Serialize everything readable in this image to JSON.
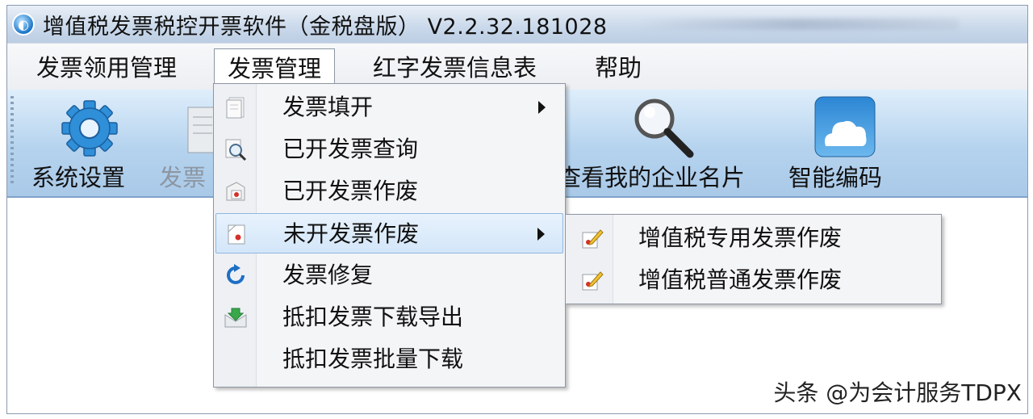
{
  "window": {
    "title": "增值税发票税控开票软件（金税盘版） V2.2.32.181028",
    "icon": "app-logo-icon"
  },
  "menubar": {
    "items": [
      {
        "label": "发票领用管理"
      },
      {
        "label": "发票管理",
        "active": true
      },
      {
        "label": "红字发票信息表"
      },
      {
        "label": "帮助"
      }
    ]
  },
  "toolbar": {
    "buttons": [
      {
        "label": "系统设置",
        "icon": "gear-icon"
      },
      {
        "label": "发票",
        "icon": "invoice-icon",
        "partially_hidden": true
      },
      {
        "label": "查看我的企业名片",
        "icon": "magnifier-icon",
        "partially_hidden": true
      },
      {
        "label": "智能编码",
        "icon": "cloud-icon"
      }
    ]
  },
  "dropdown": {
    "items": [
      {
        "label": "发票填开",
        "icon": "invoice-fill-icon",
        "has_submenu": true
      },
      {
        "label": "已开发票查询",
        "icon": "invoice-search-icon"
      },
      {
        "label": "已开发票作废",
        "icon": "invoice-void-icon"
      },
      {
        "label": "未开发票作废",
        "icon": "blank-invoice-void-icon",
        "has_submenu": true,
        "highlighted": true
      },
      {
        "label": "发票修复",
        "icon": "repair-refresh-icon"
      },
      {
        "label": "抵扣发票下载导出",
        "icon": "download-export-icon"
      },
      {
        "label": "抵扣发票批量下载",
        "icon": ""
      }
    ]
  },
  "submenu": {
    "items": [
      {
        "label": "增值税专用发票作废",
        "icon": "edit-pen-icon"
      },
      {
        "label": "增值税普通发票作废",
        "icon": "edit-pen-icon"
      }
    ]
  },
  "watermark": "头条 @为会计服务TDPX",
  "colors": {
    "toolbar_top": "#dfeefb",
    "toolbar_bottom": "#a9c9e8",
    "highlight_border": "#8fb7e0",
    "highlight_fill": "#d3e6fa"
  }
}
